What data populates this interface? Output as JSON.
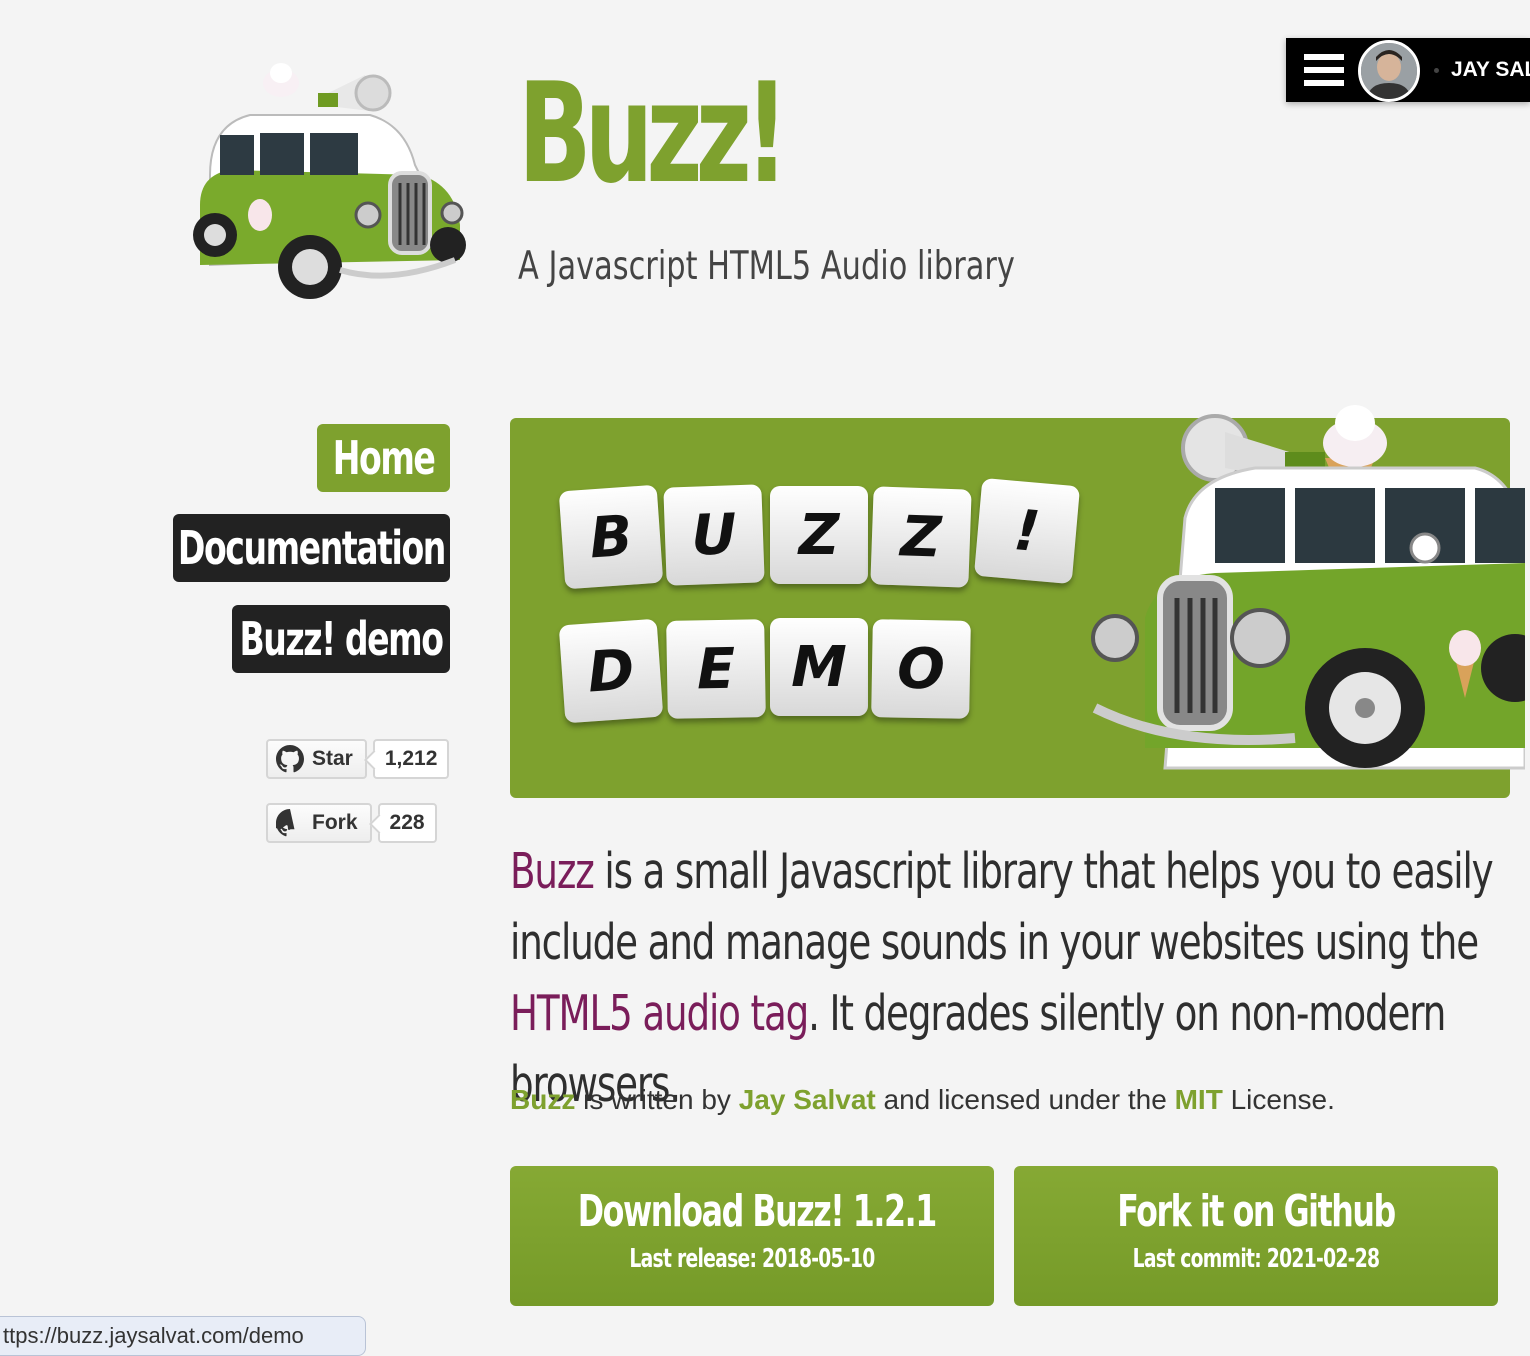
{
  "header": {
    "title": "Buzz!",
    "subtitle": "A Javascript HTML5 Audio library"
  },
  "author_bar": {
    "name": "JAY SAL",
    "menu_icon": "hamburger-icon"
  },
  "nav": {
    "items": [
      {
        "label": "Home",
        "active": true
      },
      {
        "label": "Documentation",
        "active": false
      },
      {
        "label": "Buzz! demo",
        "active": false
      }
    ]
  },
  "github": {
    "star_label": "Star",
    "star_count": "1,212",
    "fork_label": "Fork",
    "fork_count": "228",
    "icon": "github-icon"
  },
  "banner": {
    "row1": [
      "B",
      "U",
      "Z",
      "Z",
      "!"
    ],
    "row2": [
      "D",
      "E",
      "M",
      "O"
    ]
  },
  "intro": {
    "link1": "Buzz",
    "part1": " is a small Javascript library that helps you to easily include and manage sounds in your websites using the ",
    "link2": "HTML5 audio tag",
    "part2": ". It degrades silently on non-modern browsers."
  },
  "credits": {
    "link1": "Buzz",
    "part1": " is written by ",
    "link2": "Jay Salvat",
    "part2": " and licensed under the ",
    "link3": "MIT",
    "part3": " License."
  },
  "cta": {
    "download_title": "Download Buzz! 1.2.1",
    "download_sub": "Last release: 2018-05-10",
    "fork_title": "Fork it on Github",
    "fork_sub": "Last commit: 2021-02-28"
  },
  "status_bar": {
    "url": "ttps://buzz.jaysalvat.com/demo"
  },
  "colors": {
    "accent_green": "#7ea12e",
    "link_purple": "#7a1d5a",
    "nav_dark": "#222222",
    "background": "#f4f4f4"
  }
}
